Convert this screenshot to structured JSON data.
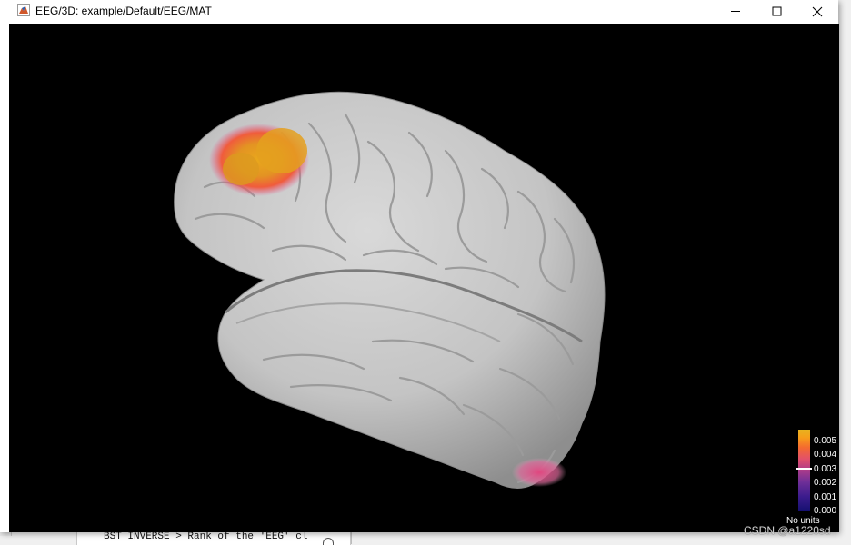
{
  "window": {
    "title": "EEG/3D: example/Default/EEG/MAT",
    "controls": [
      "minimize",
      "maximize",
      "close"
    ]
  },
  "icons": {
    "app": "matlab-figure-icon",
    "minimize": "minimize-icon",
    "maximize": "maximize-icon",
    "close": "close-icon"
  },
  "colors": {
    "canvas_background": "#000000",
    "cortex": "#cfcfcf",
    "activation_high": "#e7a51c",
    "activation_mid": "#f0643a",
    "activation_low": "#d84a8a"
  },
  "colorbar": {
    "ticks": [
      "0.005",
      "0.004",
      "0.003",
      "0.002",
      "0.001",
      "0.000"
    ],
    "units": "No units"
  },
  "background_console": {
    "text": "BST INVERSE > Rank of the 'EEG' cl"
  },
  "watermark": "CSDN @a1220sd"
}
